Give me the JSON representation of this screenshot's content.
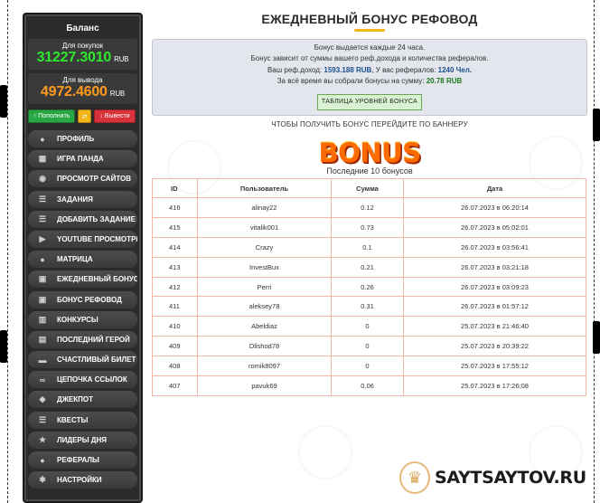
{
  "sidebar": {
    "balance_title": "Баланс",
    "purchase": {
      "label": "Для покупок",
      "amount": "31227.3010",
      "currency": "RUB"
    },
    "withdraw": {
      "label": "Для вывода",
      "amount": "4972.4600",
      "currency": "RUB"
    },
    "buttons": {
      "topup": "↑ Пополнить",
      "exchange": "⇄",
      "withdraw": "↓ Вывести"
    },
    "items": [
      {
        "label": "ПРОФИЛЬ",
        "icon": "user-icon"
      },
      {
        "label": "ИГРА ПАНДА",
        "icon": "basket-icon"
      },
      {
        "label": "ПРОСМОТР САЙТОВ",
        "icon": "eye-icon"
      },
      {
        "label": "ЗАДАНИЯ",
        "icon": "list-icon"
      },
      {
        "label": "ДОБАВИТЬ ЗАДАНИЕ",
        "icon": "list-add-icon"
      },
      {
        "label": "YOUTUBE ПРОСМОТРЫ",
        "icon": "youtube-icon"
      },
      {
        "label": "МАТРИЦА",
        "icon": "user-plus-icon"
      },
      {
        "label": "ЕЖЕДНЕВНЫЙ БОНУС",
        "icon": "gift-icon"
      },
      {
        "label": "БОНУС РЕФОВОД",
        "icon": "gift-icon"
      },
      {
        "label": "КОНКУРСЫ",
        "icon": "chart-icon"
      },
      {
        "label": "ПОСЛЕДНИЙ ГЕРОЙ",
        "icon": "film-icon"
      },
      {
        "label": "СЧАСТЛИВЫЙ БИЛЕТ",
        "icon": "ticket-icon"
      },
      {
        "label": "ЦЕПОЧКА ССЫЛОК",
        "icon": "link-icon"
      },
      {
        "label": "ДЖЕКПОТ",
        "icon": "dice-icon"
      },
      {
        "label": "КВЕСТЫ",
        "icon": "quest-list-icon"
      },
      {
        "label": "ЛИДЕРЫ ДНЯ",
        "icon": "star-icon"
      },
      {
        "label": "РЕФЕРАЛЫ",
        "icon": "users-icon"
      },
      {
        "label": "НАСТРОЙКИ",
        "icon": "gear-icon"
      }
    ]
  },
  "main": {
    "title": "ЕЖЕДНЕВНЫЙ БОНУС РЕФОВОД",
    "info": {
      "line1": "Бонус выдается каждые 24 часа.",
      "line2": "Бонус зависит от суммы вашего реф.дохода и количества рефералов.",
      "income_label": "Ваш реф.доход:",
      "income_value": "1593.188 RUB",
      "refs_label": ", У вас рефералов:",
      "refs_value": "1240 Чел.",
      "total_label": "За всё время вы собрали бонусы на сумму:",
      "total_value": "20.78 RUB",
      "levels_button": "ТАБЛИЦА УРОВНЕЙ БОНУСА"
    },
    "banner_text": "ЧТОБЫ ПОЛУЧИТЬ БОНУС ПЕРЕЙДИТЕ ПО БАННЕРУ",
    "bonus_logo": "BONUS",
    "last_text": "Последние 10 бонусов",
    "table": {
      "headers": [
        "ID",
        "Пользователь",
        "Сумма",
        "Дата"
      ],
      "rows": [
        [
          "416",
          "alinay22",
          "0.12",
          "26.07.2023 в 06:20:14"
        ],
        [
          "415",
          "vitalik001",
          "0.73",
          "26.07.2023 в 05:02:01"
        ],
        [
          "414",
          "Crazy",
          "0.1",
          "26.07.2023 в 03:56:41"
        ],
        [
          "413",
          "InvestBux",
          "0.21",
          "26.07.2023 в 03:21:18"
        ],
        [
          "412",
          "Perri",
          "0.26",
          "26.07.2023 в 03:09:23"
        ],
        [
          "411",
          "aleksey78",
          "0.31",
          "26.07.2023 в 01:57:12"
        ],
        [
          "410",
          "Abeldiaz",
          "0",
          "25.07.2023 в 21:46:40"
        ],
        [
          "409",
          "Dlishod78",
          "0",
          "25.07.2023 в 20:39:22"
        ],
        [
          "408",
          "romik8097",
          "0",
          "25.07.2023 в 17:55:12"
        ],
        [
          "407",
          "pavuk69",
          "0.06",
          "25.07.2023 в 17:26:08"
        ]
      ]
    }
  },
  "watermark": {
    "text": "SAYTSAYTOV.RU"
  },
  "colors": {
    "accent": "#f2b51a",
    "purchase": "#2ee82e",
    "withdraw": "#ff9a1e",
    "table_border": "#f0b8a4"
  }
}
